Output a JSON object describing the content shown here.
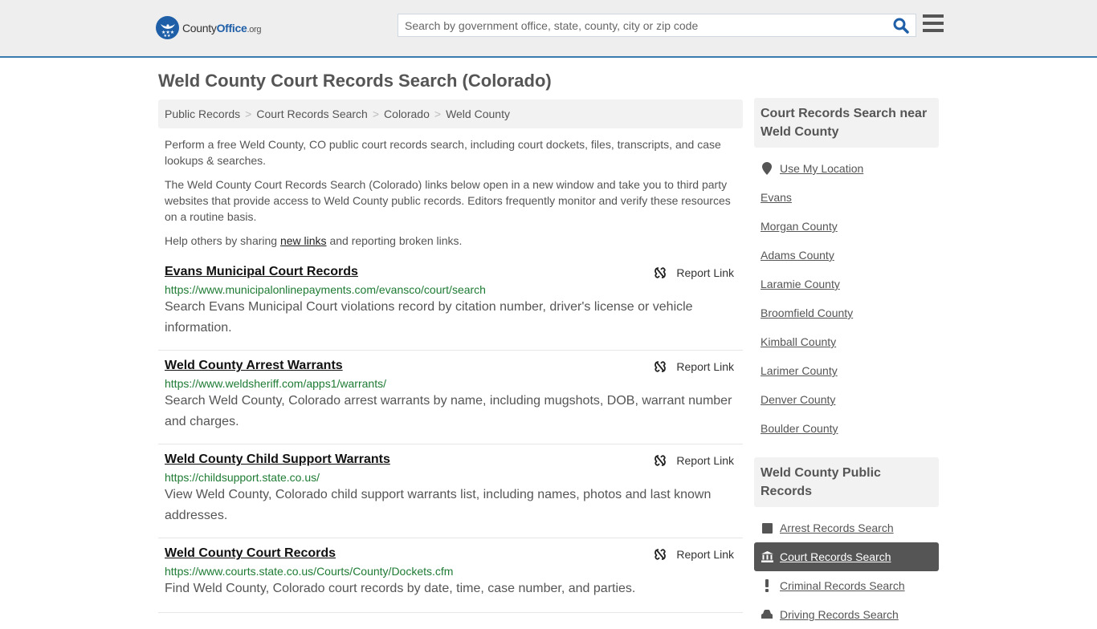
{
  "header": {
    "logo": {
      "brand_county": "County",
      "brand_office": "Office",
      "brand_tld": ".org"
    },
    "search": {
      "placeholder": "Search by government office, state, county, city or zip code",
      "value": ""
    },
    "icons": {
      "search": "search-icon",
      "menu": "hamburger-menu-icon"
    }
  },
  "page": {
    "title": "Weld County Court Records Search (Colorado)",
    "breadcrumb": [
      "Public Records",
      "Court Records Search",
      "Colorado",
      "Weld County"
    ],
    "intro": {
      "p1": "Perform a free Weld County, CO public court records search, including court dockets, files, transcripts, and case lookups & searches.",
      "p2": "The Weld County Court Records Search (Colorado) links below open in a new window and take you to third party websites that provide access to Weld County public records. Editors frequently monitor and verify these resources on a routine basis.",
      "p3_before": "Help others by sharing ",
      "p3_link": "new links",
      "p3_after": " and reporting broken links."
    }
  },
  "results": [
    {
      "title": "Evans Municipal Court Records",
      "url": "https://www.municipalonlinepayments.com/evansco/court/search",
      "description": "Search Evans Municipal Court violations record by citation number, driver's license or vehicle information.",
      "report_label": "Report Link"
    },
    {
      "title": "Weld County Arrest Warrants",
      "url": "https://www.weldsheriff.com/apps1/warrants/",
      "description": "Search Weld County, Colorado arrest warrants by name, including mugshots, DOB, warrant number and charges.",
      "report_label": "Report Link"
    },
    {
      "title": "Weld County Child Support Warrants",
      "url": "https://childsupport.state.co.us/",
      "description": "View Weld County, Colorado child support warrants list, including names, photos and last known addresses.",
      "report_label": "Report Link"
    },
    {
      "title": "Weld County Court Records",
      "url": "https://www.courts.state.co.us/Courts/County/Dockets.cfm",
      "description": "Find Weld County, Colorado court records by date, time, case number, and parties.",
      "report_label": "Report Link"
    }
  ],
  "sidebar": {
    "nearby": {
      "heading": "Court Records Search near Weld County",
      "use_location": "Use My Location",
      "items": [
        "Evans",
        "Morgan County",
        "Adams County",
        "Laramie County",
        "Broomfield County",
        "Kimball County",
        "Larimer County",
        "Denver County",
        "Boulder County"
      ]
    },
    "public_records": {
      "heading": "Weld County Public Records",
      "items": [
        {
          "label": "Arrest Records Search",
          "icon": "square-icon",
          "active": false
        },
        {
          "label": "Court Records Search",
          "icon": "courthouse-icon",
          "active": true
        },
        {
          "label": "Criminal Records Search",
          "icon": "exclamation-icon",
          "active": false
        },
        {
          "label": "Driving Records Search",
          "icon": "car-icon",
          "active": false
        }
      ]
    }
  },
  "colors": {
    "brand_blue": "#1f5fa8",
    "header_border": "#3a7cae",
    "url_green": "#1e7b34",
    "active_item_bg": "#555555"
  }
}
